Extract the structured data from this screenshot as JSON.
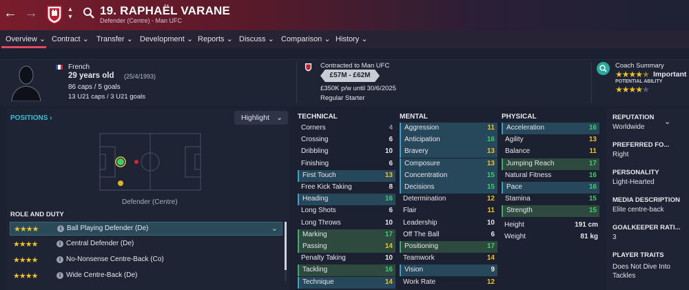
{
  "header": {
    "player_title": "19. RAPHAËL VARANE",
    "player_subtitle": "Defender (Centre) - Man UFC",
    "nationality": "French",
    "age": "29 years old",
    "dob": "(25/4/1993)",
    "caps": "86 caps / 5 goals",
    "u21_caps": "13 U21 caps / 3 U21 goals",
    "contract_label": "Contracted to Man UFC",
    "value_range": "£57M - £62M",
    "wage": "£350K p/w until 30/6/2025",
    "squad_status": "Regular Starter",
    "coach_summary_label": "Coach Summary",
    "coach_summary_text": "Important p",
    "potential_label": "POTENTIAL ABILITY",
    "current_stars": 4,
    "potential_stars": 4
  },
  "tabs": [
    {
      "label": "Overview"
    },
    {
      "label": "Contract"
    },
    {
      "label": "Transfer"
    },
    {
      "label": "Development"
    },
    {
      "label": "Reports"
    },
    {
      "label": "Discuss"
    },
    {
      "label": "Comparison"
    },
    {
      "label": "History"
    }
  ],
  "positions": {
    "title": "POSITIONS",
    "highlight_button": "Highlight",
    "pitch_label": "Defender (Centre)"
  },
  "role_and_duty": {
    "title": "ROLE AND DUTY",
    "roles": [
      {
        "label": "Ball Playing Defender (De)",
        "stars": 4
      },
      {
        "label": "Central Defender (De)",
        "stars": 4
      },
      {
        "label": "No-Nonsense Centre-Back (Co)",
        "stars": 4
      },
      {
        "label": "Wide Centre-Back (De)",
        "stars": 4
      }
    ]
  },
  "attributes": {
    "technical": {
      "title": "TECHNICAL",
      "items": [
        {
          "name": "Corners",
          "value": "4"
        },
        {
          "name": "Crossing",
          "value": "6"
        },
        {
          "name": "Dribbling",
          "value": "10"
        },
        {
          "name": "Finishing",
          "value": "6"
        },
        {
          "name": "First Touch",
          "value": "13"
        },
        {
          "name": "Free Kick Taking",
          "value": "8"
        },
        {
          "name": "Heading",
          "value": "16"
        },
        {
          "name": "Long Shots",
          "value": "6"
        },
        {
          "name": "Long Throws",
          "value": "10"
        },
        {
          "name": "Marking",
          "value": "17"
        },
        {
          "name": "Passing",
          "value": "14"
        },
        {
          "name": "Penalty Taking",
          "value": "10"
        },
        {
          "name": "Tackling",
          "value": "16"
        },
        {
          "name": "Technique",
          "value": "14"
        }
      ]
    },
    "mental": {
      "title": "MENTAL",
      "items": [
        {
          "name": "Aggression",
          "value": "11"
        },
        {
          "name": "Anticipation",
          "value": "16"
        },
        {
          "name": "Bravery",
          "value": "13"
        },
        {
          "name": "Composure",
          "value": "13"
        },
        {
          "name": "Concentration",
          "value": "15"
        },
        {
          "name": "Decisions",
          "value": "15"
        },
        {
          "name": "Determination",
          "value": "12"
        },
        {
          "name": "Flair",
          "value": "11"
        },
        {
          "name": "Leadership",
          "value": "10"
        },
        {
          "name": "Off The Ball",
          "value": "6"
        },
        {
          "name": "Positioning",
          "value": "17"
        },
        {
          "name": "Teamwork",
          "value": "14"
        },
        {
          "name": "Vision",
          "value": "9"
        },
        {
          "name": "Work Rate",
          "value": "12"
        }
      ]
    },
    "physical": {
      "title": "PHYSICAL",
      "items": [
        {
          "name": "Acceleration",
          "value": "16"
        },
        {
          "name": "Agility",
          "value": "13"
        },
        {
          "name": "Balance",
          "value": "11"
        },
        {
          "name": "Jumping Reach",
          "value": "17"
        },
        {
          "name": "Natural Fitness",
          "value": "16"
        },
        {
          "name": "Pace",
          "value": "16"
        },
        {
          "name": "Stamina",
          "value": "15"
        },
        {
          "name": "Strength",
          "value": "15"
        }
      ],
      "height_label": "Height",
      "height": "191 cm",
      "weight_label": "Weight",
      "weight": "81 kg"
    }
  },
  "info_panel": {
    "reputation_label": "REPUTATION",
    "reputation": "Worldwide",
    "preferred_foot_label": "PREFERRED FO...",
    "preferred_foot": "Right",
    "personality_label": "PERSONALITY",
    "personality": "Light-Hearted",
    "media_label": "MEDIA DESCRIPTION",
    "media": "Elite centre-back",
    "gk_label": "GOALKEEPER RATI...",
    "gk": "3",
    "traits_label": "PLAYER TRAITS",
    "traits": "Does Not Dive Into Tackles"
  },
  "colors": {
    "accent": "#e14a5f",
    "value_green": "#3fce6e",
    "value_yellow": "#f0c22a",
    "value_white": "#e6e8ee",
    "value_grey": "#8a90a0",
    "link_blue": "#3bbfd6"
  }
}
